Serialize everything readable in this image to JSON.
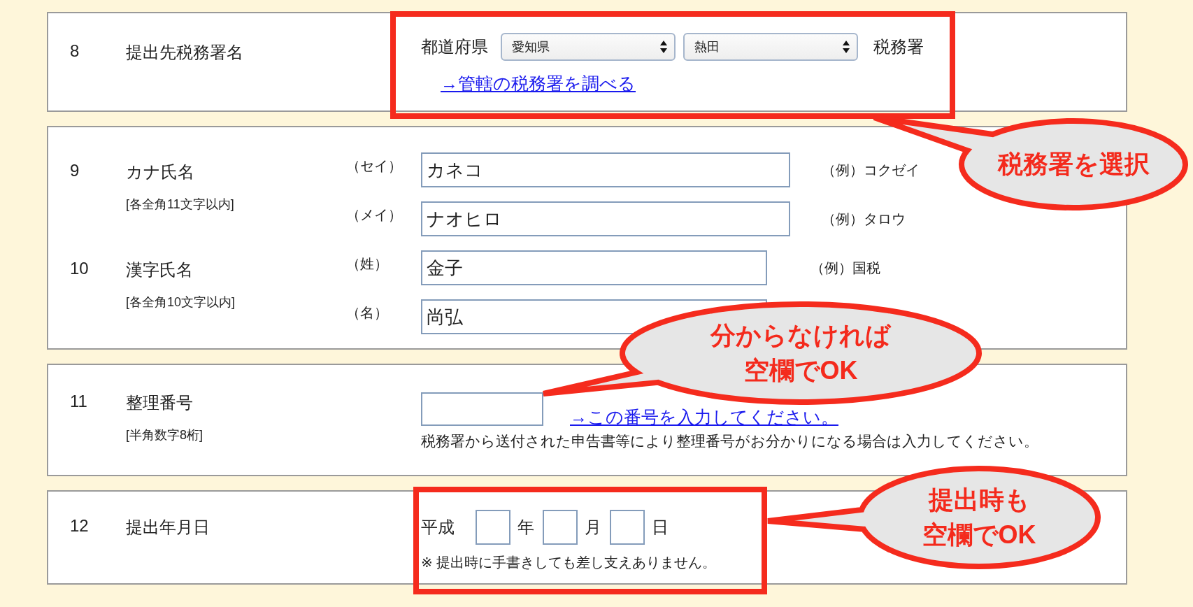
{
  "sections": [
    {
      "kind": "office",
      "number": "8",
      "label": "提出先税務署名",
      "prefecture_label": "都道府県",
      "prefecture": "愛知県",
      "office": "熱田",
      "suffix": "税務署",
      "link": "→管轄の税務署を調べる"
    },
    {
      "kind": "names",
      "groups": [
        {
          "number": "9",
          "label": "カナ氏名",
          "note": "[各全角11文字以内]",
          "fields": [
            {
              "label": "（セイ）",
              "value": "カネコ",
              "example": "（例）コクゼイ"
            },
            {
              "label": "（メイ）",
              "value": "ナオヒロ",
              "example": "（例）タロウ"
            }
          ]
        },
        {
          "number": "10",
          "label": "漢字氏名",
          "note": "[各全角10文字以内]",
          "fields": [
            {
              "label": "（姓）",
              "value": "金子",
              "example": "（例）国税"
            },
            {
              "label": "（名）",
              "value": "尚弘"
            }
          ]
        }
      ]
    },
    {
      "kind": "refnum",
      "number": "11",
      "label": "整理番号",
      "note": "[半角数字8桁]",
      "link": "→この番号を入力してください。",
      "help": "税務署から送付された申告書等により整理番号がお分かりになる場合は入力してください。"
    },
    {
      "kind": "date",
      "number": "12",
      "label": "提出年月日",
      "era": "平成",
      "units": [
        "年",
        "月",
        "日"
      ],
      "note": "※ 提出時に手書きしても差し支えありません。"
    }
  ],
  "annotations": [
    {
      "lines": [
        "税務署を選択"
      ],
      "framed": true
    },
    {
      "lines": [
        "分からなければ",
        "空欄でOK"
      ],
      "framed": false
    },
    {
      "lines": [
        "提出時も",
        "空欄でOK"
      ],
      "framed": true
    }
  ]
}
